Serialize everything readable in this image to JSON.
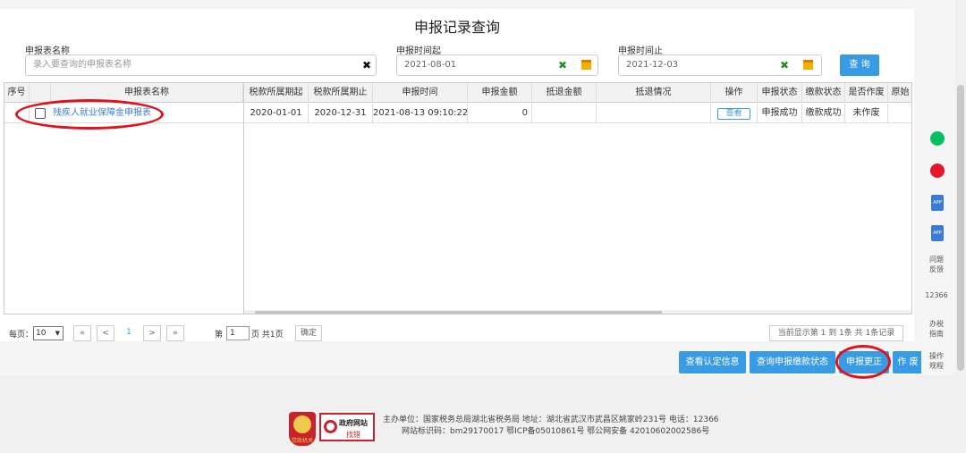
{
  "page_title": "申报记录查询",
  "filters": {
    "name_label": "申报表名称",
    "name_placeholder": "录入要查询的申报表名称",
    "start_label": "申报时间起",
    "start_value": "2021-08-01",
    "end_label": "申报时间止",
    "end_value": "2021-12-03",
    "clear_glyph": "✖",
    "query_label": "查 询"
  },
  "table": {
    "headers": [
      "序号",
      "申报表名称",
      "税款所属期起",
      "税款所属期止",
      "申报时间",
      "申报金额",
      "抵退金额",
      "抵退情况",
      "操作",
      "申报状态",
      "缴款状态",
      "是否作废",
      "原始"
    ],
    "rows": [
      {
        "name": "残疾人就业保障金申报表",
        "period_start": "2020-01-01",
        "period_end": "2020-12-31",
        "declare_time": "2021-08-13 09:10:22",
        "amount": "0",
        "refund_amount": "",
        "refund_status": "",
        "action": "查看",
        "declare_status": "申报成功",
        "pay_status": "缴款成功",
        "void_status": "未作废"
      }
    ]
  },
  "pager": {
    "per_page_label": "每页：",
    "per_page_value": "10",
    "first": "«",
    "prev": "<",
    "current": "1",
    "next": ">",
    "last": "»",
    "page_prefix": "第",
    "page_input": "1",
    "page_suffix": "页 共1页",
    "confirm": "确定",
    "summary": "当前显示第  1 到  1条 共  1条记录"
  },
  "actions": {
    "view_cert": "查看认定信息",
    "query_pay": "查询申报缴款状态",
    "correct": "申报更正",
    "void": "作 废"
  },
  "sidebar": {
    "app1": "APP",
    "app2": "APP",
    "feedback": "问题\n反馈",
    "hotline": "12366",
    "guide": "办税\n指南",
    "manual": "操作\n规程"
  },
  "footer": {
    "line1": "主办单位：国家税务总局湖北省税务局   地址：湖北省武汉市武昌区姚家岭231号 电话：12366",
    "line2": "网站标识码：bm29170017   鄂ICP备05010861号 鄂公网安备 42010602002586号",
    "badge_label": "政府网站",
    "badge_sub": "找错",
    "emblem_label": "党政机关"
  },
  "colors": {
    "accent": "#3a9be5",
    "annotation": "#e0121b"
  }
}
